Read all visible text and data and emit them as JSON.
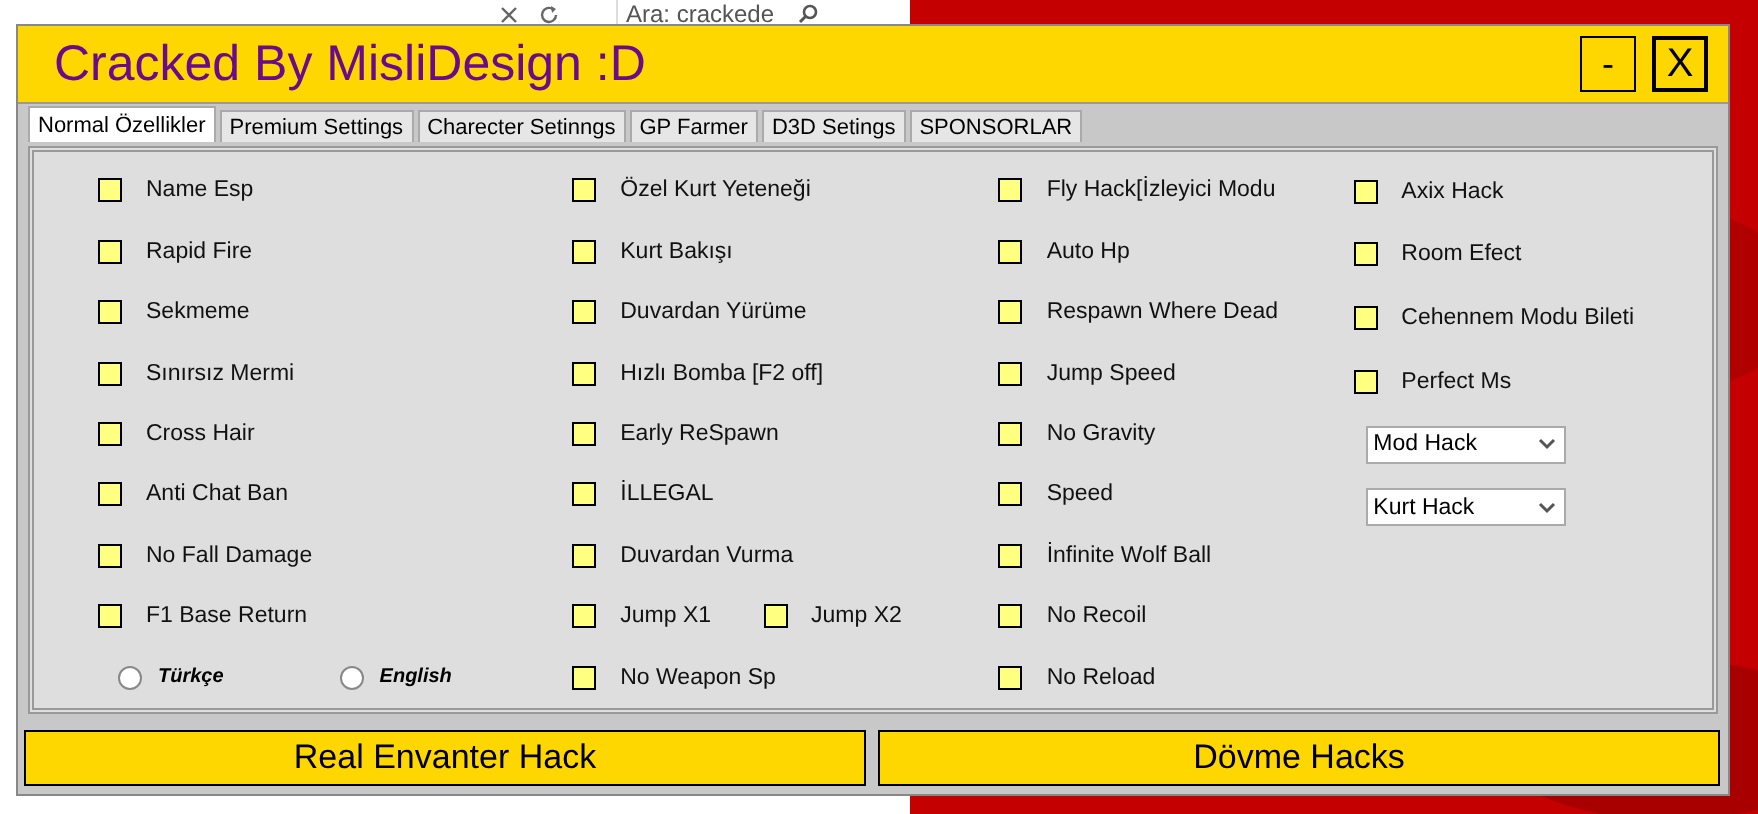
{
  "background_page": {
    "search_text": "Ara: crackede"
  },
  "window": {
    "title": "Cracked By MisliDesign :D",
    "buttons": [
      "-",
      "X"
    ]
  },
  "tabs": [
    {
      "label": "Normal Özellikler",
      "selected": true
    },
    {
      "label": "Premium Settings",
      "selected": false
    },
    {
      "label": "Charecter Setinngs",
      "selected": false
    },
    {
      "label": "GP Farmer",
      "selected": false
    },
    {
      "label": "D3D Setings",
      "selected": false
    },
    {
      "label": "SPONSORLAR",
      "selected": false
    }
  ],
  "columns": [
    {
      "rows": [
        [
          {
            "kind": "checkbox",
            "label": "Name Esp",
            "checked": false
          }
        ],
        [
          {
            "kind": "checkbox",
            "label": "Rapid Fire",
            "checked": false
          }
        ],
        [
          {
            "kind": "checkbox",
            "label": "Sekmeme",
            "checked": false
          }
        ],
        [
          {
            "kind": "checkbox",
            "label": "Sınırsız Mermi",
            "checked": false
          }
        ],
        [
          {
            "kind": "checkbox",
            "label": "Cross Hair",
            "checked": false
          }
        ],
        [
          {
            "kind": "checkbox",
            "label": "Anti Chat Ban",
            "checked": false
          }
        ],
        [
          {
            "kind": "checkbox",
            "label": "No Fall Damage",
            "checked": false
          }
        ],
        [
          {
            "kind": "checkbox",
            "label": "F1 Base Return",
            "checked": false
          }
        ],
        [
          {
            "kind": "radio",
            "label": "Türkçe",
            "selected": false
          },
          {
            "kind": "radio",
            "label": "English",
            "selected": false
          }
        ]
      ]
    },
    {
      "rows": [
        [
          {
            "kind": "checkbox",
            "label": "Özel Kurt Yeteneği",
            "checked": false
          }
        ],
        [
          {
            "kind": "checkbox",
            "label": "Kurt Bakışı",
            "checked": false
          }
        ],
        [
          {
            "kind": "checkbox",
            "label": "Duvardan Yürüme",
            "checked": false
          }
        ],
        [
          {
            "kind": "checkbox",
            "label": "Hızlı Bomba [F2 off]",
            "checked": false
          }
        ],
        [
          {
            "kind": "checkbox",
            "label": "Early ReSpawn",
            "checked": false
          }
        ],
        [
          {
            "kind": "checkbox",
            "label": "İLLEGAL",
            "checked": false
          }
        ],
        [
          {
            "kind": "checkbox",
            "label": "Duvardan Vurma",
            "checked": false
          }
        ],
        [
          {
            "kind": "checkbox",
            "label": "Jump X1",
            "checked": false
          },
          {
            "kind": "checkbox",
            "label": "Jump X2",
            "checked": false
          }
        ],
        [
          {
            "kind": "checkbox",
            "label": "No Weapon Sp",
            "checked": false
          }
        ]
      ]
    },
    {
      "rows": [
        [
          {
            "kind": "checkbox",
            "label": "Fly Hack[İzleyici Modu",
            "checked": false
          }
        ],
        [
          {
            "kind": "checkbox",
            "label": "Auto Hp",
            "checked": false
          }
        ],
        [
          {
            "kind": "checkbox",
            "label": "Respawn Where Dead",
            "checked": false
          }
        ],
        [
          {
            "kind": "checkbox",
            "label": "Jump Speed",
            "checked": false
          }
        ],
        [
          {
            "kind": "checkbox",
            "label": "No Gravity",
            "checked": false
          }
        ],
        [
          {
            "kind": "checkbox",
            "label": "Speed",
            "checked": false
          }
        ],
        [
          {
            "kind": "checkbox",
            "label": "İnfinite Wolf Ball",
            "checked": false
          }
        ],
        [
          {
            "kind": "checkbox",
            "label": "No Recoil",
            "checked": false
          }
        ],
        [
          {
            "kind": "checkbox",
            "label": "No Reload",
            "checked": false
          }
        ]
      ]
    },
    {
      "rows": [
        [
          {
            "kind": "checkbox",
            "label": "Axix Hack",
            "checked": false
          }
        ],
        [
          {
            "kind": "checkbox",
            "label": "Room Efect",
            "checked": false
          }
        ],
        [
          {
            "kind": "checkbox",
            "label": "Cehennem Modu Bileti",
            "checked": false
          }
        ],
        [
          {
            "kind": "checkbox",
            "label": "Perfect Ms",
            "checked": false
          }
        ],
        [
          {
            "kind": "dropdown",
            "value": "Mod Hack"
          }
        ],
        [
          {
            "kind": "dropdown",
            "value": "Kurt Hack"
          }
        ]
      ]
    }
  ],
  "bottom_buttons": [
    "Real Envanter Hack",
    "Dövme Hacks"
  ]
}
